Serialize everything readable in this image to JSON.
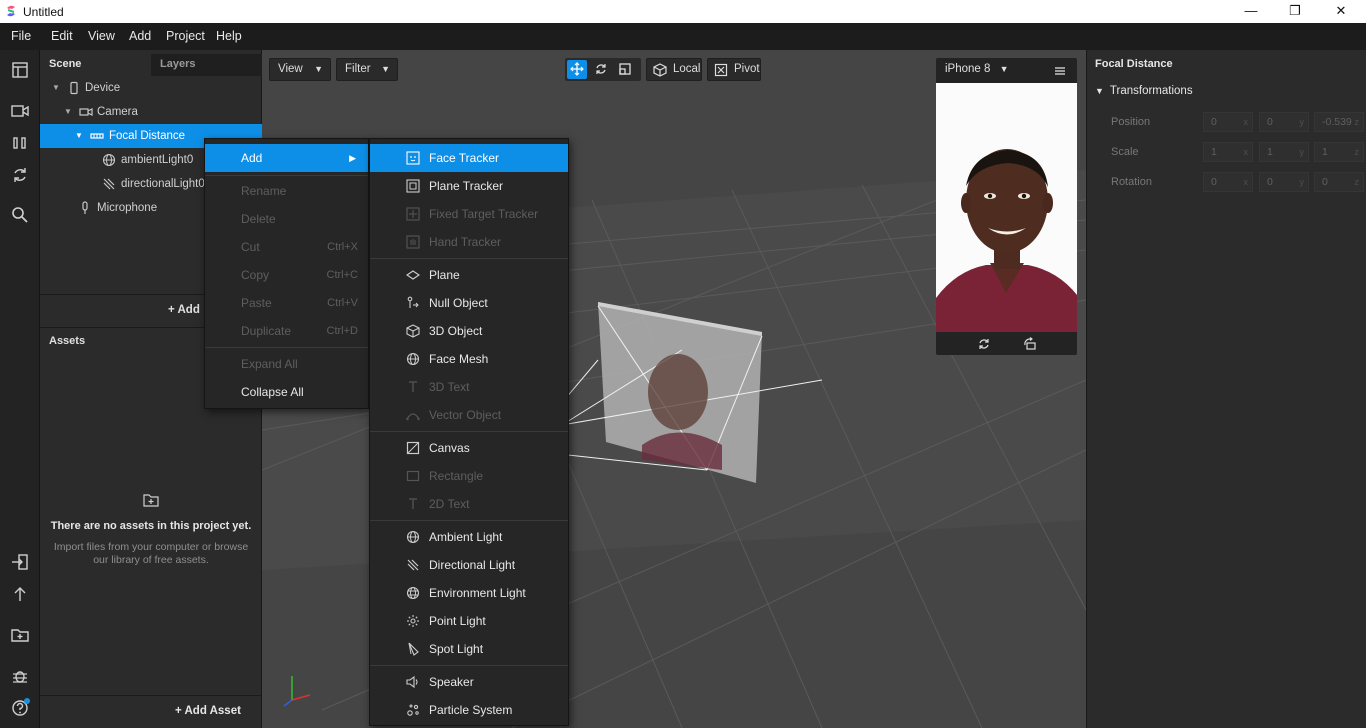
{
  "window": {
    "title": "Untitled",
    "minimize_glyph": "—",
    "maximize_glyph": "❐",
    "close_glyph": "✕"
  },
  "menubar": {
    "items": [
      "File",
      "Edit",
      "View",
      "Add",
      "Project",
      "Help"
    ]
  },
  "scene": {
    "tab_scene": "Scene",
    "tab_layers": "Layers",
    "tree": [
      {
        "label": "Device",
        "icon": "device-icon"
      },
      {
        "label": "Camera",
        "icon": "camera-icon"
      },
      {
        "label": "Focal Distance",
        "icon": "focal-distance-icon",
        "selected": true
      },
      {
        "label": "ambientLight0",
        "icon": "ambient-light-icon"
      },
      {
        "label": "directionalLight0",
        "icon": "directional-light-icon"
      },
      {
        "label": "Microphone",
        "icon": "microphone-icon"
      }
    ],
    "add_label": "Add"
  },
  "assets": {
    "header": "Assets",
    "empty_title": "There are no assets in this project yet.",
    "empty_desc": "Import files from your computer or browse our library of free assets.",
    "add_asset_label": "Add Asset"
  },
  "viewport": {
    "view_label": "View",
    "filter_label": "Filter",
    "local_label": "Local",
    "pivot_label": "Pivot",
    "device_label": "iPhone 8"
  },
  "inspector": {
    "title": "Focal Distance",
    "section": "Transformations",
    "properties": [
      {
        "label": "Position",
        "values": [
          "0",
          "0",
          "-0.539"
        ],
        "axes": [
          "x",
          "y",
          "z"
        ]
      },
      {
        "label": "Scale",
        "values": [
          "1",
          "1",
          "1"
        ],
        "axes": [
          "x",
          "y",
          "z"
        ]
      },
      {
        "label": "Rotation",
        "values": [
          "0",
          "0",
          "0"
        ],
        "axes": [
          "x",
          "y",
          "z"
        ]
      }
    ]
  },
  "context_menu": {
    "add": "Add",
    "rename": "Rename",
    "delete": "Delete",
    "cut": "Cut",
    "cut_sc": "Ctrl+X",
    "copy": "Copy",
    "copy_sc": "Ctrl+C",
    "paste": "Paste",
    "paste_sc": "Ctrl+V",
    "duplicate": "Duplicate",
    "duplicate_sc": "Ctrl+D",
    "expand_all": "Expand All",
    "collapse_all": "Collapse All"
  },
  "add_submenu": {
    "face_tracker": "Face Tracker",
    "plane_tracker": "Plane Tracker",
    "fixed_target_tracker": "Fixed Target Tracker",
    "hand_tracker": "Hand Tracker",
    "plane": "Plane",
    "null_object": "Null Object",
    "object_3d": "3D Object",
    "face_mesh": "Face Mesh",
    "text_3d": "3D Text",
    "vector_object": "Vector Object",
    "canvas": "Canvas",
    "rectangle": "Rectangle",
    "text_2d": "2D Text",
    "ambient_light": "Ambient Light",
    "directional_light": "Directional Light",
    "environment_light": "Environment Light",
    "point_light": "Point Light",
    "spot_light": "Spot Light",
    "speaker": "Speaker",
    "particle_system": "Particle System"
  },
  "colors": {
    "accent": "#0d8fe8",
    "panel": "#2b2b2b",
    "viewport": "#454545",
    "menu": "#262626"
  }
}
